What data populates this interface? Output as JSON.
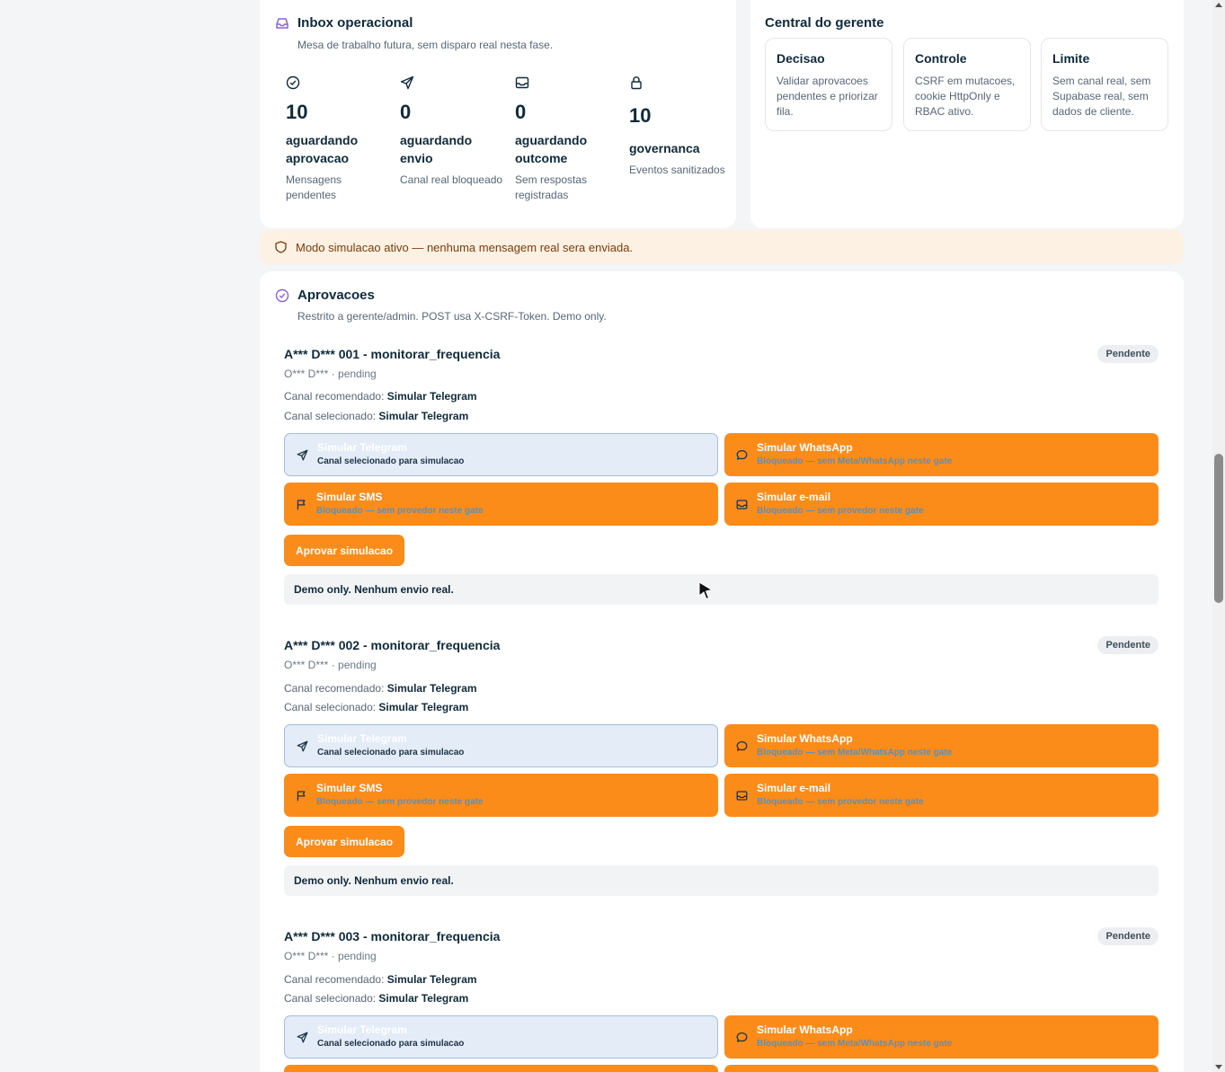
{
  "inbox": {
    "title": "Inbox operacional",
    "subtitle": "Mesa de trabalho futura, sem disparo real nesta fase.",
    "icon": "inbox-icon",
    "stats": [
      {
        "icon": "check-circle-icon",
        "value": "10",
        "label": "aguardando aprovacao",
        "desc": "Mensagens pendentes"
      },
      {
        "icon": "send-icon",
        "value": "0",
        "label": "aguardando envio",
        "desc": "Canal real bloqueado"
      },
      {
        "icon": "inbox-tray-icon",
        "value": "0",
        "label": "aguardando outcome",
        "desc": "Sem respostas registradas"
      },
      {
        "icon": "lock-icon",
        "value": "10",
        "label": "governanca",
        "desc": "Eventos sanitizados"
      }
    ]
  },
  "manager": {
    "title": "Central do gerente",
    "boxes": [
      {
        "title": "Decisao",
        "desc": "Validar aprovacoes pendentes e priorizar fila."
      },
      {
        "title": "Controle",
        "desc": "CSRF em mutacoes, cookie HttpOnly e RBAC ativo."
      },
      {
        "title": "Limite",
        "desc": "Sem canal real, sem Supabase real, sem dados de cliente."
      }
    ]
  },
  "banner": {
    "icon": "shield-icon",
    "text": "Modo simulacao ativo — nenhuma mensagem real sera enviada."
  },
  "approvals": {
    "title": "Aprovacoes",
    "subtitle": "Restrito a gerente/admin. POST usa X-CSRF-Token. Demo only.",
    "icon": "check-circle-icon",
    "labels": {
      "recommended": "Canal recomendado:",
      "selected": "Canal selecionado:",
      "approve": "Aprovar simulacao",
      "demo": "Demo only. Nenhum envio real.",
      "badge": "Pendente"
    },
    "channels": {
      "telegram": {
        "name": "Simular Telegram",
        "note": "Canal selecionado para simulacao",
        "icon": "send-icon"
      },
      "whatsapp": {
        "name": "Simular WhatsApp",
        "note": "Bloqueado — sem Meta/WhatsApp neste gate",
        "icon": "chat-bubble-icon"
      },
      "sms": {
        "name": "Simular SMS",
        "note": "Bloqueado — sem provedor neste gate",
        "icon": "flag-icon"
      },
      "email": {
        "name": "Simular e-mail",
        "note": "Bloqueado — sem provedor neste gate",
        "icon": "inbox-tray-icon"
      }
    },
    "items": [
      {
        "title": "A*** D*** 001 - monitorar_frequencia",
        "meta": "O*** D*** · pending",
        "recommended": "Simular Telegram",
        "selected": "Simular Telegram"
      },
      {
        "title": "A*** D*** 002 - monitorar_frequencia",
        "meta": "O*** D*** · pending",
        "recommended": "Simular Telegram",
        "selected": "Simular Telegram"
      },
      {
        "title": "A*** D*** 003 - monitorar_frequencia",
        "meta": "O*** D*** · pending",
        "recommended": "Simular Telegram",
        "selected": "Simular Telegram"
      }
    ]
  }
}
